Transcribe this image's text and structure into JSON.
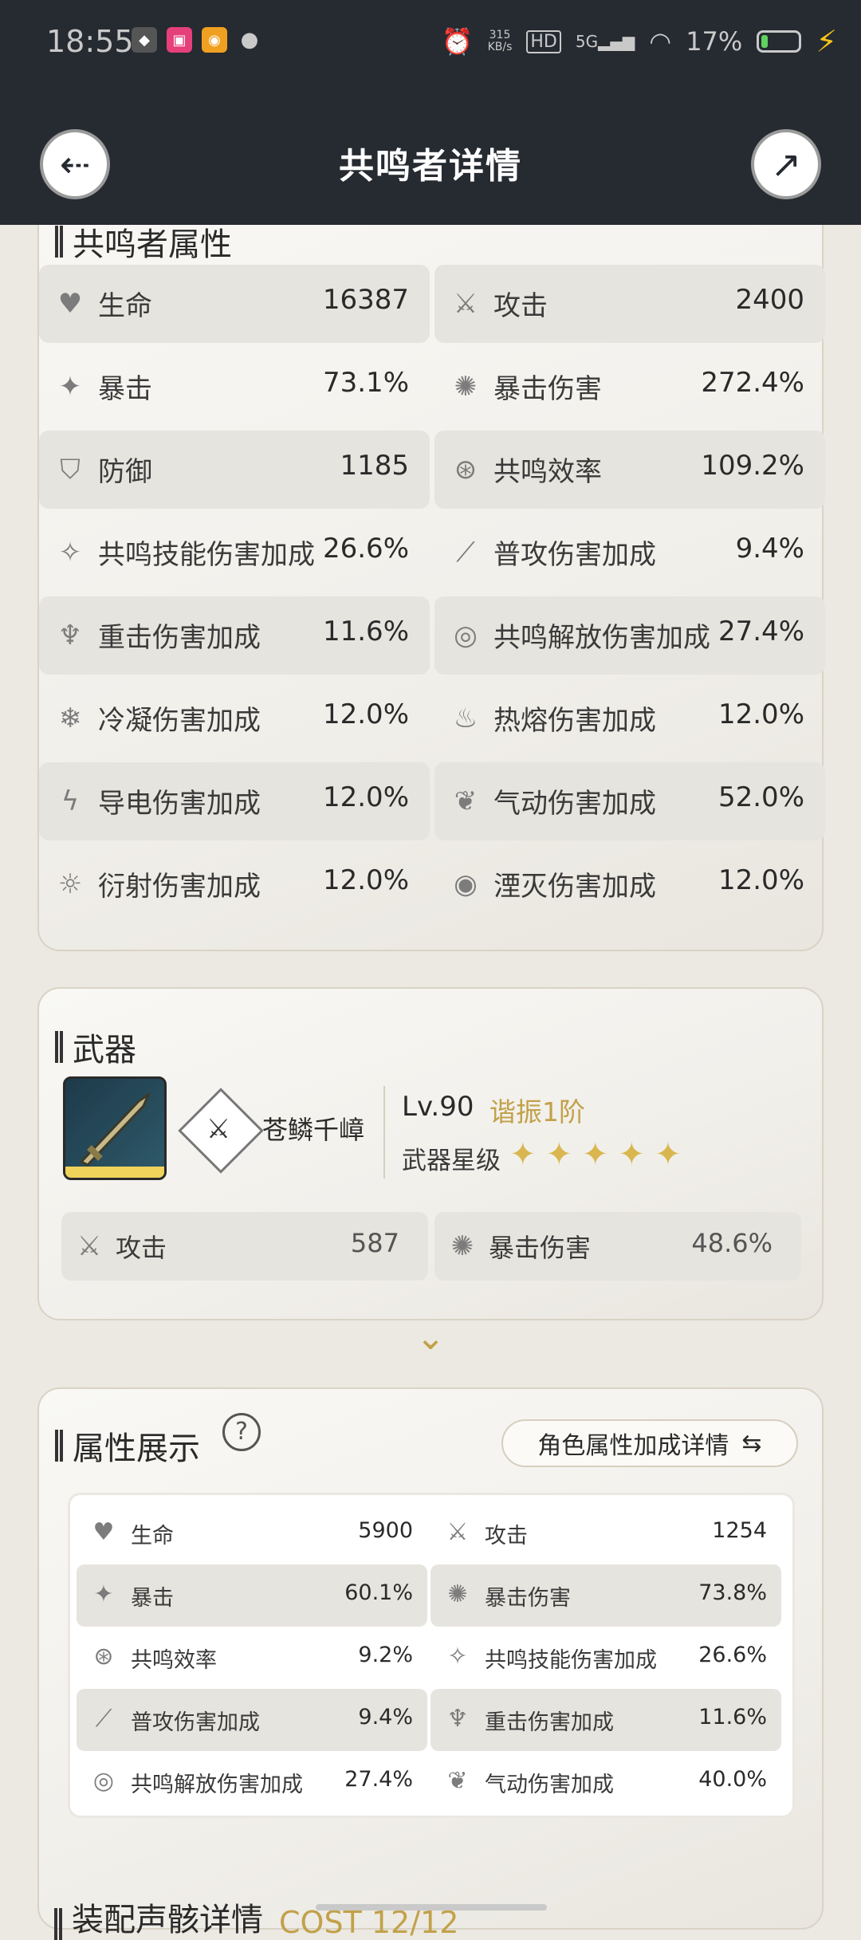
{
  "status_bar": {
    "time": "18:55",
    "speed_value": "315",
    "speed_unit": "KB/s",
    "hd": "HD",
    "net": "5G",
    "battery": "17%"
  },
  "header": {
    "title": "共鸣者详情"
  },
  "resonator_attributes": {
    "title": "共鸣者属性",
    "rows": [
      {
        "left": {
          "icon": "heart-icon",
          "label": "生命",
          "value": "16387"
        },
        "right": {
          "icon": "sword-icon",
          "label": "攻击",
          "value": "2400"
        }
      },
      {
        "left": {
          "icon": "crit-icon",
          "label": "暴击",
          "value": "73.1%"
        },
        "right": {
          "icon": "crit-damage-icon",
          "label": "暴击伤害",
          "value": "272.4%"
        }
      },
      {
        "left": {
          "icon": "shield-icon",
          "label": "防御",
          "value": "1185"
        },
        "right": {
          "icon": "energy-regen-icon",
          "label": "共鸣效率",
          "value": "109.2%"
        }
      },
      {
        "left": {
          "icon": "skill-icon",
          "label": "共鸣技能伤害加成",
          "value": "26.6%"
        },
        "right": {
          "icon": "basic-attack-icon",
          "label": "普攻伤害加成",
          "value": "9.4%"
        }
      },
      {
        "left": {
          "icon": "heavy-attack-icon",
          "label": "重击伤害加成",
          "value": "11.6%"
        },
        "right": {
          "icon": "liberation-icon",
          "label": "共鸣解放伤害加成",
          "value": "27.4%"
        }
      },
      {
        "left": {
          "icon": "glacio-icon",
          "label": "冷凝伤害加成",
          "value": "12.0%"
        },
        "right": {
          "icon": "fusion-icon",
          "label": "热熔伤害加成",
          "value": "12.0%"
        }
      },
      {
        "left": {
          "icon": "electro-icon",
          "label": "导电伤害加成",
          "value": "12.0%"
        },
        "right": {
          "icon": "aero-icon",
          "label": "气动伤害加成",
          "value": "52.0%"
        }
      },
      {
        "left": {
          "icon": "spectro-icon",
          "label": "衍射伤害加成",
          "value": "12.0%"
        },
        "right": {
          "icon": "havoc-icon",
          "label": "湮灭伤害加成",
          "value": "12.0%"
        }
      }
    ]
  },
  "weapon": {
    "title": "武器",
    "name": "苍鳞千嶂",
    "level": "Lv.90",
    "tune": "谐振1阶",
    "star_label": "武器星级",
    "stars": 5,
    "stats": [
      {
        "icon": "sword-icon",
        "label": "攻击",
        "value": "587"
      },
      {
        "icon": "crit-damage-icon",
        "label": "暴击伤害",
        "value": "48.6%"
      }
    ]
  },
  "attribute_display": {
    "title": "属性展示",
    "help": "?",
    "detail_button": "角色属性加成详情",
    "rows": [
      {
        "left": {
          "icon": "heart-icon",
          "label": "生命",
          "value": "5900"
        },
        "right": {
          "icon": "sword-icon",
          "label": "攻击",
          "value": "1254"
        }
      },
      {
        "left": {
          "icon": "crit-icon",
          "label": "暴击",
          "value": "60.1%"
        },
        "right": {
          "icon": "crit-damage-icon",
          "label": "暴击伤害",
          "value": "73.8%"
        }
      },
      {
        "left": {
          "icon": "energy-regen-icon",
          "label": "共鸣效率",
          "value": "9.2%"
        },
        "right": {
          "icon": "skill-icon",
          "label": "共鸣技能伤害加成",
          "value": "26.6%"
        }
      },
      {
        "left": {
          "icon": "basic-attack-icon",
          "label": "普攻伤害加成",
          "value": "9.4%"
        },
        "right": {
          "icon": "heavy-attack-icon",
          "label": "重击伤害加成",
          "value": "11.6%"
        }
      },
      {
        "left": {
          "icon": "liberation-icon",
          "label": "共鸣解放伤害加成",
          "value": "27.4%"
        },
        "right": {
          "icon": "aero-icon",
          "label": "气动伤害加成",
          "value": "40.0%"
        }
      }
    ]
  },
  "echo_section": {
    "title": "装配声骸详情",
    "cost": "COST 12/12"
  }
}
